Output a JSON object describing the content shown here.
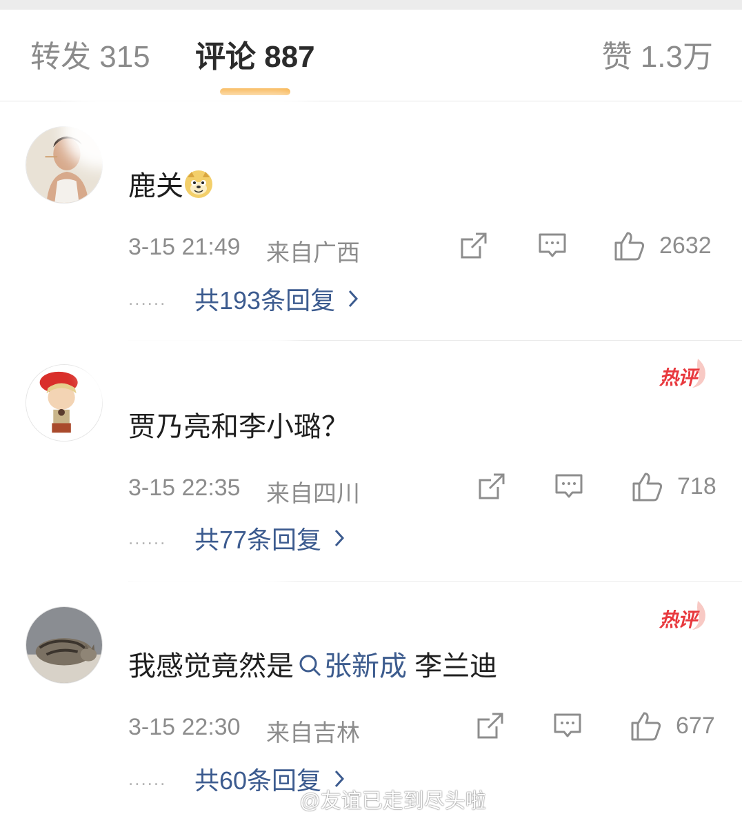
{
  "tabs": {
    "reposts": "转发 315",
    "comments": "评论 887",
    "likes": "赞 1.3万"
  },
  "colors": {
    "accent_underline": "#f7a935",
    "link": "#3c5b8f",
    "hot_badge": "#e8383d"
  },
  "comments": [
    {
      "name": "",
      "text": "鹿关",
      "emoji": "doge-emoji",
      "time": "3-15 21:49",
      "source": "来自广西",
      "likes": "2632",
      "replies": "共193条回复",
      "hot": false
    },
    {
      "name": "",
      "text": "贾乃亮和李小璐？",
      "time": "3-15 22:35",
      "source": "来自四川",
      "likes": "718",
      "replies": "共77条回复",
      "hot": true,
      "hot_label": "热评"
    },
    {
      "name": "",
      "text_before": "我感觉竟然是",
      "topic": "张新成",
      "text_after": " 李兰迪",
      "time": "3-15 22:30",
      "source": "来自吉林",
      "likes": "677",
      "replies": "共60条回复",
      "hot": true,
      "hot_label": "热评"
    }
  ],
  "watermark": "@友谊已走到尽头啦"
}
